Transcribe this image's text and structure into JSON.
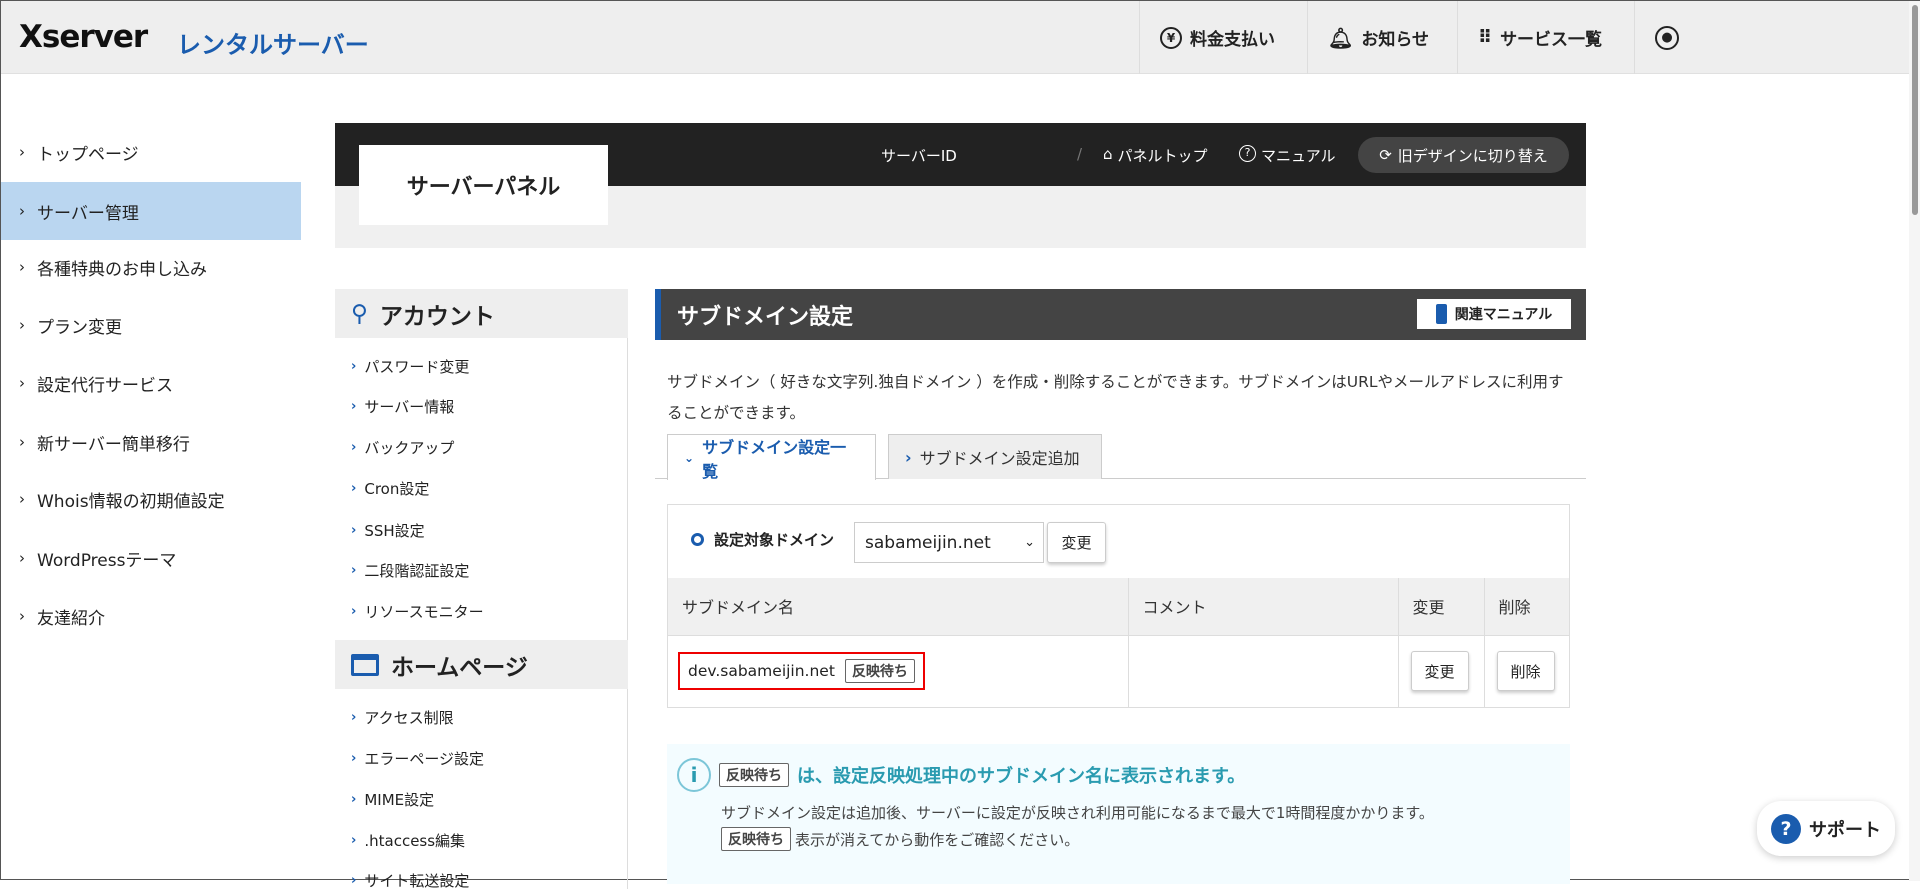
{
  "header": {
    "logo": "Xserver",
    "logo_sub": "レンタルサーバー",
    "nav": [
      {
        "label": "料金支払い",
        "icon": "yen-icon"
      },
      {
        "label": "お知らせ",
        "icon": "bell-icon"
      },
      {
        "label": "サービス一覧",
        "icon": "grid-icon"
      }
    ],
    "account_icon": "user-icon"
  },
  "sidebar": {
    "items": [
      {
        "label": "トップページ"
      },
      {
        "label": "サーバー管理",
        "active": true
      },
      {
        "label": "各種特典のお申し込み"
      },
      {
        "label": "プラン変更"
      },
      {
        "label": "設定代行サービス"
      },
      {
        "label": "新サーバー簡単移行"
      },
      {
        "label": "Whois情報の初期値設定"
      },
      {
        "label": "WordPressテーマ"
      },
      {
        "label": "友達紹介"
      }
    ]
  },
  "panel": {
    "title": "サーバーパネル",
    "server_id_label": "サーバーID",
    "panel_top": "パネルトップ",
    "manual": "マニュアル",
    "old_design": "旧デザインに切り替え"
  },
  "leftnav": {
    "sections": [
      {
        "title": "アカウント",
        "items": [
          "パスワード変更",
          "サーバー情報",
          "バックアップ",
          "Cron設定",
          "SSH設定",
          "二段階認証設定",
          "リソースモニター"
        ]
      },
      {
        "title": "ホームページ",
        "items": [
          "アクセス制限",
          "エラーページ設定",
          "MIME設定",
          ".htaccess編集",
          "サイト転送設定"
        ]
      }
    ]
  },
  "main": {
    "title": "サブドメイン設定",
    "manual_button": "関連マニュアル",
    "description": "サブドメイン（ 好きな文字列.独自ドメイン ）を作成・削除することができます。サブドメインはURLやメールアドレスに利用することができます。",
    "tabs": [
      {
        "label": "サブドメイン設定一覧",
        "active": true
      },
      {
        "label": "サブドメイン設定追加"
      }
    ],
    "domain_label": "設定対象ドメイン",
    "domain_value": "sabameijin.net",
    "change_button": "変更",
    "table": {
      "headers": [
        "サブドメイン名",
        "コメント",
        "変更",
        "削除"
      ],
      "rows": [
        {
          "subdomain": "dev.sabameijin.net",
          "status": "反映待ち",
          "comment": "",
          "change": "変更",
          "delete": "削除"
        }
      ]
    },
    "info": {
      "badge": "反映待ち",
      "headline": "は、設定反映処理中のサブドメイン名に表示されます。",
      "line1": "サブドメイン設定は追加後、サーバーに設定が反映され利用可能になるまで最大で1時間程度かかります。",
      "line2": "表示が消えてから動作をご確認ください。"
    }
  },
  "support": {
    "label": "サポート"
  },
  "colors": {
    "brand": "#1a5cae",
    "active_sidebar": "#bad6f0",
    "info": "#2a9bb0",
    "highlight": "#e00000"
  }
}
